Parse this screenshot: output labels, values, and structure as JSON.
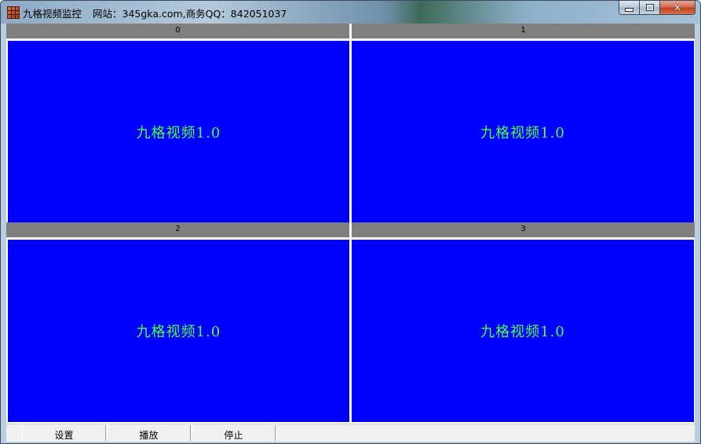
{
  "window": {
    "app_name": "九格视频监控",
    "site_info": "网站：345gka.com,商务QQ：842051037",
    "caption": {
      "minimize_icon": "minimize-icon",
      "maximize_icon": "maximize-icon",
      "close_symbol": "✕"
    }
  },
  "cells": [
    {
      "header": "0",
      "label": "九格视频1.0"
    },
    {
      "header": "1",
      "label": "九格视频1.0"
    },
    {
      "header": "2",
      "label": "九格视频1.0"
    },
    {
      "header": "3",
      "label": "九格视频1.0"
    }
  ],
  "toolbar": {
    "settings_label": "设置",
    "play_label": "播放",
    "stop_label": "停止"
  },
  "colors": {
    "video_background": "#0000fe",
    "video_text": "#44ff44",
    "header_background": "#7f7f7f"
  }
}
